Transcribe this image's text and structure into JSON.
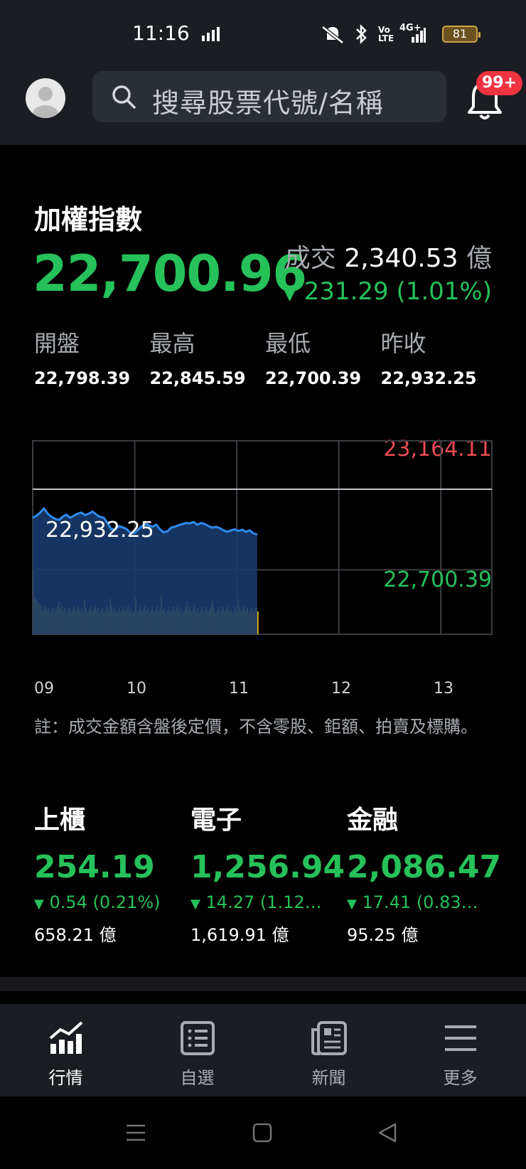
{
  "status_bar": {
    "time": "11:16",
    "battery": "81",
    "network": "4G+"
  },
  "header": {
    "search_placeholder": "搜尋股票代號/名稱",
    "notification_badge": "99+"
  },
  "index": {
    "title": "加權指數",
    "price": "22,700.96",
    "volume_label": "成交",
    "volume_value": "2,340.53",
    "volume_unit": "億",
    "change": "231.29 (1.01%)",
    "stats": [
      {
        "label": "開盤",
        "value": "22,798.39"
      },
      {
        "label": "最高",
        "value": "22,845.59"
      },
      {
        "label": "最低",
        "value": "22,700.39"
      },
      {
        "label": "昨收",
        "value": "22,932.25"
      }
    ]
  },
  "chart": {
    "high_label": "23,164.11",
    "prev_close_label": "22,932.25",
    "low_label": "22,700.39",
    "x_ticks": [
      "09",
      "10",
      "11",
      "12",
      "13"
    ]
  },
  "chart_data": {
    "type": "area",
    "x_ticks": [
      "09",
      "10",
      "11",
      "12",
      "13"
    ],
    "ylim": [
      22236.39,
      23164.11
    ],
    "reference_line": 22932.25,
    "price_series": [
      22795,
      22805,
      22820,
      22840,
      22815,
      22800,
      22790,
      22785,
      22800,
      22810,
      22795,
      22805,
      22815,
      22820,
      22808,
      22815,
      22825,
      22810,
      22800,
      22795,
      22770,
      22740,
      22738,
      22755,
      22750,
      22742,
      22725,
      22722,
      22735,
      22752,
      22765,
      22760,
      22752,
      22762,
      22740,
      22725,
      22730,
      22748,
      22752,
      22760,
      22765,
      22770,
      22768,
      22775,
      22762,
      22770,
      22765,
      22755,
      22748,
      22752,
      22745,
      22735,
      22728,
      22735,
      22740,
      22732,
      22738,
      22728,
      22735,
      22720,
      22715
    ],
    "colors": {
      "up": "#ef4b55",
      "down": "#26c15a",
      "line": "#2e8bf0",
      "volume": "#f2c21b"
    }
  },
  "note": "註：成交金額含盤後定價，不含零股、鉅額、拍賣及標購。",
  "sub_indices": [
    {
      "name": "上櫃",
      "price": "254.19",
      "change": "0.54 (0.21%)",
      "volume": "658.21 億"
    },
    {
      "name": "電子",
      "price": "1,256.94",
      "change": "14.27 (1.12…",
      "volume": "1,619.91 億"
    },
    {
      "name": "金融",
      "price": "2,086.47",
      "change": "17.41 (0.83…",
      "volume": "95.25 億"
    }
  ],
  "nav": [
    {
      "label": "行情",
      "icon": "chart-icon",
      "active": true
    },
    {
      "label": "自選",
      "icon": "list-icon",
      "active": false
    },
    {
      "label": "新聞",
      "icon": "news-icon",
      "active": false
    },
    {
      "label": "更多",
      "icon": "menu-icon",
      "active": false
    }
  ]
}
